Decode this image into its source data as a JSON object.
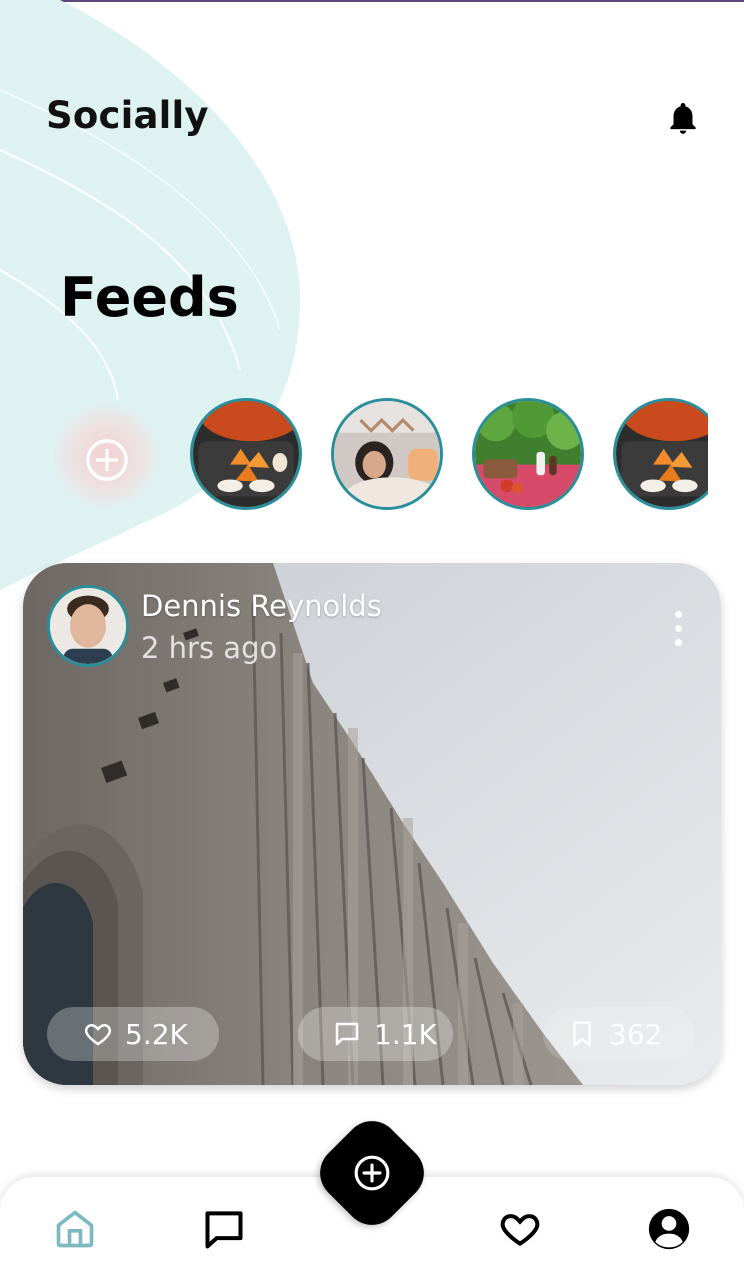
{
  "app": {
    "title": "Socially"
  },
  "header": {
    "notification_icon": "bell-icon"
  },
  "feed": {
    "heading": "Feeds"
  },
  "stories": {
    "add_icon": "plus-circle-icon",
    "items": [
      {
        "subject": "food-platter"
      },
      {
        "subject": "woman-portrait"
      },
      {
        "subject": "picnic-table"
      },
      {
        "subject": "food-platter"
      }
    ]
  },
  "post": {
    "author": "Dennis Reynolds",
    "time": "2 hrs ago",
    "likes": "5.2K",
    "comments": "1.1K",
    "saves": "362",
    "icons": {
      "like": "heart-icon",
      "comment": "comment-icon",
      "save": "bookmark-icon",
      "more": "more-vertical-icon"
    }
  },
  "bottom_nav": {
    "items": [
      {
        "name": "home",
        "icon": "home-icon",
        "active": true
      },
      {
        "name": "messages",
        "icon": "chat-icon",
        "active": false
      },
      {
        "name": "create",
        "icon": "plus-circle-icon",
        "active": false
      },
      {
        "name": "favorites",
        "icon": "heart-icon",
        "active": false
      },
      {
        "name": "profile",
        "icon": "user-circle-icon",
        "active": false
      }
    ]
  },
  "colors": {
    "accent": "#2a8f9a",
    "active_nav": "#7db9bf",
    "blob": "#dff2f2"
  }
}
